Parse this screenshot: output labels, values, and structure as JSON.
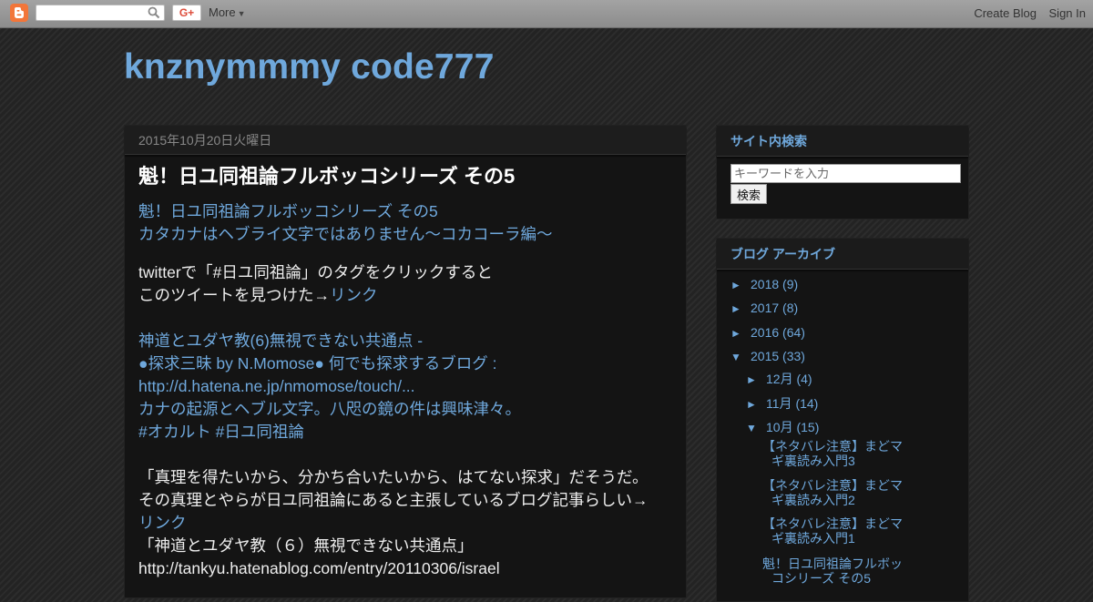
{
  "navbar": {
    "search_value": "",
    "gplus_label": "G+",
    "more_label": "More",
    "create_blog_label": "Create Blog",
    "sign_in_label": "Sign In"
  },
  "blog": {
    "title": "knznymmmy code777"
  },
  "post": {
    "date": "2015年10月20日火曜日",
    "title": "魁！日ユ同祖論フルボッコシリーズ その5",
    "intro_line1": "魁！日ユ同祖論フルボッコシリーズ その5",
    "intro_line2": "カタカナはヘブライ文字ではありません〜コカコーラ編〜",
    "p2_line1": "twitterで「#日ユ同祖論」のタグをクリックすると",
    "p2_line2_text": "このツイートを見つけた→",
    "p2_line2_link": "リンク",
    "q1": "神道とユダヤ教(6)無視できない共通点 -",
    "q2": "●探求三昧 by N.Momose● 何でも探求するブログ :",
    "q3": "http://d.hatena.ne.jp/nmomose/touch/...",
    "q4": "カナの起源とヘブル文字。八咫の鏡の件は興味津々。",
    "q5": "#オカルト #日ユ同祖論",
    "p3_line1": "「真理を得たいから、分かち合いたいから、はてない探求」だそうだ。",
    "p3_line2": "その真理とやらが日ユ同祖論にあると主張しているブログ記事らしい→",
    "p3_link": "リンク",
    "p3_line4": "「神道とユダヤ教（６）無視できない共通点」",
    "p3_line5": "http://tankyu.hatenablog.com/entry/20110306/israel"
  },
  "sidebar": {
    "search": {
      "title": "サイト内検索",
      "placeholder": "キーワードを入力",
      "button_label": "検索"
    },
    "archive": {
      "title": "ブログ アーカイブ",
      "years": [
        {
          "toggle": "►",
          "label": "2018",
          "count": "(9)"
        },
        {
          "toggle": "►",
          "label": "2017",
          "count": "(8)"
        },
        {
          "toggle": "►",
          "label": "2016",
          "count": "(64)"
        },
        {
          "toggle": "▼",
          "label": "2015",
          "count": "(33)"
        }
      ],
      "months": [
        {
          "toggle": "►",
          "label": "12月",
          "count": "(4)"
        },
        {
          "toggle": "►",
          "label": "11月",
          "count": "(14)"
        },
        {
          "toggle": "▼",
          "label": "10月",
          "count": "(15)"
        }
      ],
      "posts": [
        {
          "line1": "【ネタバレ注意】まどマ",
          "line2": "ギ裏読み入門3"
        },
        {
          "line1": "【ネタバレ注意】まどマ",
          "line2": "ギ裏読み入門2"
        },
        {
          "line1": "【ネタバレ注意】まどマ",
          "line2": "ギ裏読み入門1"
        },
        {
          "line1": "魁！日ユ同祖論フルボッ",
          "line2": "コシリーズ その5"
        }
      ]
    }
  }
}
